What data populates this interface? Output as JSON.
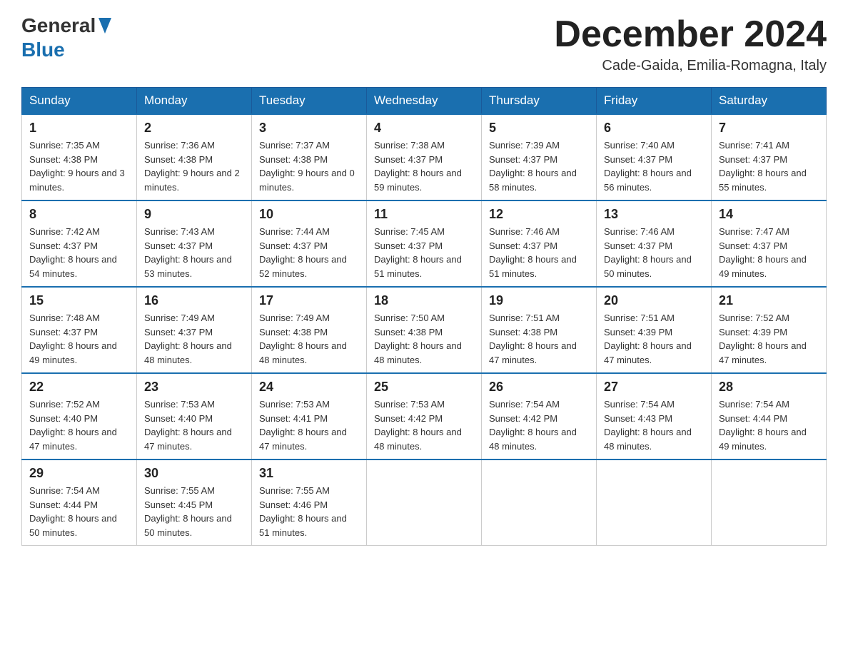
{
  "header": {
    "logo": {
      "general": "General",
      "blue": "Blue"
    },
    "title": "December 2024",
    "location": "Cade-Gaida, Emilia-Romagna, Italy"
  },
  "days_of_week": [
    "Sunday",
    "Monday",
    "Tuesday",
    "Wednesday",
    "Thursday",
    "Friday",
    "Saturday"
  ],
  "weeks": [
    [
      {
        "day": "1",
        "sunrise": "7:35 AM",
        "sunset": "4:38 PM",
        "daylight": "9 hours and 3 minutes."
      },
      {
        "day": "2",
        "sunrise": "7:36 AM",
        "sunset": "4:38 PM",
        "daylight": "9 hours and 2 minutes."
      },
      {
        "day": "3",
        "sunrise": "7:37 AM",
        "sunset": "4:38 PM",
        "daylight": "9 hours and 0 minutes."
      },
      {
        "day": "4",
        "sunrise": "7:38 AM",
        "sunset": "4:37 PM",
        "daylight": "8 hours and 59 minutes."
      },
      {
        "day": "5",
        "sunrise": "7:39 AM",
        "sunset": "4:37 PM",
        "daylight": "8 hours and 58 minutes."
      },
      {
        "day": "6",
        "sunrise": "7:40 AM",
        "sunset": "4:37 PM",
        "daylight": "8 hours and 56 minutes."
      },
      {
        "day": "7",
        "sunrise": "7:41 AM",
        "sunset": "4:37 PM",
        "daylight": "8 hours and 55 minutes."
      }
    ],
    [
      {
        "day": "8",
        "sunrise": "7:42 AM",
        "sunset": "4:37 PM",
        "daylight": "8 hours and 54 minutes."
      },
      {
        "day": "9",
        "sunrise": "7:43 AM",
        "sunset": "4:37 PM",
        "daylight": "8 hours and 53 minutes."
      },
      {
        "day": "10",
        "sunrise": "7:44 AM",
        "sunset": "4:37 PM",
        "daylight": "8 hours and 52 minutes."
      },
      {
        "day": "11",
        "sunrise": "7:45 AM",
        "sunset": "4:37 PM",
        "daylight": "8 hours and 51 minutes."
      },
      {
        "day": "12",
        "sunrise": "7:46 AM",
        "sunset": "4:37 PM",
        "daylight": "8 hours and 51 minutes."
      },
      {
        "day": "13",
        "sunrise": "7:46 AM",
        "sunset": "4:37 PM",
        "daylight": "8 hours and 50 minutes."
      },
      {
        "day": "14",
        "sunrise": "7:47 AM",
        "sunset": "4:37 PM",
        "daylight": "8 hours and 49 minutes."
      }
    ],
    [
      {
        "day": "15",
        "sunrise": "7:48 AM",
        "sunset": "4:37 PM",
        "daylight": "8 hours and 49 minutes."
      },
      {
        "day": "16",
        "sunrise": "7:49 AM",
        "sunset": "4:37 PM",
        "daylight": "8 hours and 48 minutes."
      },
      {
        "day": "17",
        "sunrise": "7:49 AM",
        "sunset": "4:38 PM",
        "daylight": "8 hours and 48 minutes."
      },
      {
        "day": "18",
        "sunrise": "7:50 AM",
        "sunset": "4:38 PM",
        "daylight": "8 hours and 48 minutes."
      },
      {
        "day": "19",
        "sunrise": "7:51 AM",
        "sunset": "4:38 PM",
        "daylight": "8 hours and 47 minutes."
      },
      {
        "day": "20",
        "sunrise": "7:51 AM",
        "sunset": "4:39 PM",
        "daylight": "8 hours and 47 minutes."
      },
      {
        "day": "21",
        "sunrise": "7:52 AM",
        "sunset": "4:39 PM",
        "daylight": "8 hours and 47 minutes."
      }
    ],
    [
      {
        "day": "22",
        "sunrise": "7:52 AM",
        "sunset": "4:40 PM",
        "daylight": "8 hours and 47 minutes."
      },
      {
        "day": "23",
        "sunrise": "7:53 AM",
        "sunset": "4:40 PM",
        "daylight": "8 hours and 47 minutes."
      },
      {
        "day": "24",
        "sunrise": "7:53 AM",
        "sunset": "4:41 PM",
        "daylight": "8 hours and 47 minutes."
      },
      {
        "day": "25",
        "sunrise": "7:53 AM",
        "sunset": "4:42 PM",
        "daylight": "8 hours and 48 minutes."
      },
      {
        "day": "26",
        "sunrise": "7:54 AM",
        "sunset": "4:42 PM",
        "daylight": "8 hours and 48 minutes."
      },
      {
        "day": "27",
        "sunrise": "7:54 AM",
        "sunset": "4:43 PM",
        "daylight": "8 hours and 48 minutes."
      },
      {
        "day": "28",
        "sunrise": "7:54 AM",
        "sunset": "4:44 PM",
        "daylight": "8 hours and 49 minutes."
      }
    ],
    [
      {
        "day": "29",
        "sunrise": "7:54 AM",
        "sunset": "4:44 PM",
        "daylight": "8 hours and 50 minutes."
      },
      {
        "day": "30",
        "sunrise": "7:55 AM",
        "sunset": "4:45 PM",
        "daylight": "8 hours and 50 minutes."
      },
      {
        "day": "31",
        "sunrise": "7:55 AM",
        "sunset": "4:46 PM",
        "daylight": "8 hours and 51 minutes."
      },
      null,
      null,
      null,
      null
    ]
  ],
  "labels": {
    "sunrise": "Sunrise:",
    "sunset": "Sunset:",
    "daylight": "Daylight:"
  }
}
